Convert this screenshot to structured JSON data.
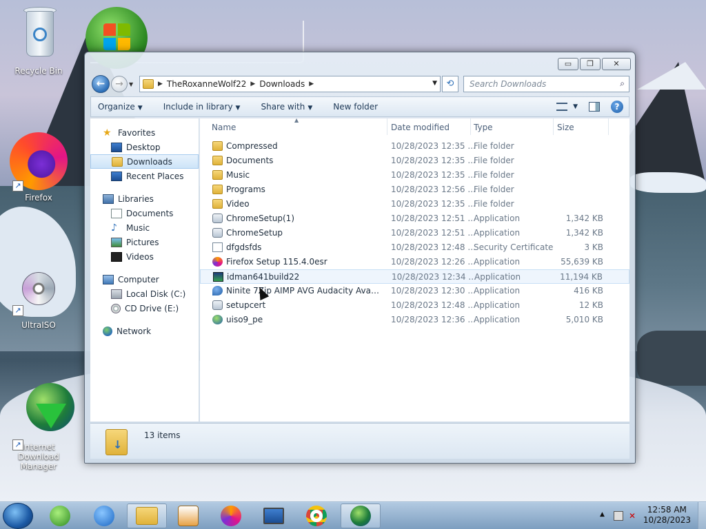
{
  "desktop": {
    "icons": [
      {
        "label": "Recycle Bin"
      },
      {
        "label": "Firefox"
      },
      {
        "label": "UltraISO"
      },
      {
        "label": "Internet Download Manager"
      }
    ]
  },
  "window": {
    "controls": {
      "minimize": "▭",
      "maximize": "❐",
      "close": "✕"
    },
    "address": {
      "root": "TheRoxanneWolf22",
      "folder": "Downloads"
    },
    "search_placeholder": "Search Downloads",
    "toolbar": {
      "organize": "Organize",
      "include": "Include in library",
      "share": "Share with",
      "new_folder": "New folder"
    },
    "nav": {
      "favorites": "Favorites",
      "desktop": "Desktop",
      "downloads": "Downloads",
      "recent": "Recent Places",
      "libraries": "Libraries",
      "documents": "Documents",
      "music": "Music",
      "pictures": "Pictures",
      "videos": "Videos",
      "computer": "Computer",
      "local_disk": "Local Disk (C:)",
      "cd_drive": "CD Drive (E:)",
      "network": "Network"
    },
    "columns": {
      "name": "Name",
      "date": "Date modified",
      "type": "Type",
      "size": "Size"
    },
    "files": [
      {
        "name": "Compressed",
        "date": "10/28/2023 12:35 ...",
        "type": "File folder",
        "size": "",
        "icon": "folder"
      },
      {
        "name": "Documents",
        "date": "10/28/2023 12:35 ...",
        "type": "File folder",
        "size": "",
        "icon": "folder"
      },
      {
        "name": "Music",
        "date": "10/28/2023 12:35 ...",
        "type": "File folder",
        "size": "",
        "icon": "folder"
      },
      {
        "name": "Programs",
        "date": "10/28/2023 12:56 ...",
        "type": "File folder",
        "size": "",
        "icon": "folder"
      },
      {
        "name": "Video",
        "date": "10/28/2023 12:35 ...",
        "type": "File folder",
        "size": "",
        "icon": "folder"
      },
      {
        "name": "ChromeSetup(1)",
        "date": "10/28/2023 12:51 ...",
        "type": "Application",
        "size": "1,342 KB",
        "icon": "app"
      },
      {
        "name": "ChromeSetup",
        "date": "10/28/2023 12:51 ...",
        "type": "Application",
        "size": "1,342 KB",
        "icon": "app"
      },
      {
        "name": "dfgdsfds",
        "date": "10/28/2023 12:48 ...",
        "type": "Security Certificate",
        "size": "3 KB",
        "icon": "cert"
      },
      {
        "name": "Firefox Setup 115.4.0esr",
        "date": "10/28/2023 12:26 ...",
        "type": "Application",
        "size": "55,639 KB",
        "icon": "fox"
      },
      {
        "name": "idman641build22",
        "date": "10/28/2023 12:34 ...",
        "type": "Application",
        "size": "11,194 KB",
        "icon": "idm"
      },
      {
        "name": "Ninite 7Zip AIMP AVG Audacity Avast Av...",
        "date": "10/28/2023 12:30 ...",
        "type": "Application",
        "size": "416 KB",
        "icon": "ninite"
      },
      {
        "name": "setupcert",
        "date": "10/28/2023 12:48 ...",
        "type": "Application",
        "size": "12 KB",
        "icon": "app"
      },
      {
        "name": "uiso9_pe",
        "date": "10/28/2023 12:36 ...",
        "type": "Application",
        "size": "5,010 KB",
        "icon": "uiso"
      }
    ],
    "hover_row": 9,
    "item_count": "13 items"
  },
  "taskbar": {
    "apps": [
      "windows-media-player",
      "internet-explorer",
      "windows-explorer",
      "media-center",
      "firefox",
      "remote-desktop",
      "chrome",
      "internet-download-manager"
    ],
    "active_app": "windows-explorer",
    "clock": {
      "time": "12:58 AM",
      "date": "10/28/2023"
    }
  }
}
